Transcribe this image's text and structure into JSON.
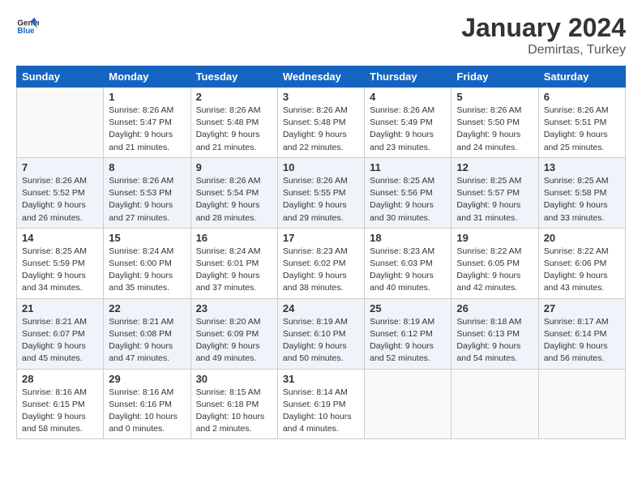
{
  "logo": {
    "text_general": "General",
    "text_blue": "Blue"
  },
  "title": {
    "month": "January 2024",
    "location": "Demirtas, Turkey"
  },
  "headers": [
    "Sunday",
    "Monday",
    "Tuesday",
    "Wednesday",
    "Thursday",
    "Friday",
    "Saturday"
  ],
  "weeks": [
    [
      {
        "day": "",
        "info": ""
      },
      {
        "day": "1",
        "info": "Sunrise: 8:26 AM\nSunset: 5:47 PM\nDaylight: 9 hours\nand 21 minutes."
      },
      {
        "day": "2",
        "info": "Sunrise: 8:26 AM\nSunset: 5:48 PM\nDaylight: 9 hours\nand 21 minutes."
      },
      {
        "day": "3",
        "info": "Sunrise: 8:26 AM\nSunset: 5:48 PM\nDaylight: 9 hours\nand 22 minutes."
      },
      {
        "day": "4",
        "info": "Sunrise: 8:26 AM\nSunset: 5:49 PM\nDaylight: 9 hours\nand 23 minutes."
      },
      {
        "day": "5",
        "info": "Sunrise: 8:26 AM\nSunset: 5:50 PM\nDaylight: 9 hours\nand 24 minutes."
      },
      {
        "day": "6",
        "info": "Sunrise: 8:26 AM\nSunset: 5:51 PM\nDaylight: 9 hours\nand 25 minutes."
      }
    ],
    [
      {
        "day": "7",
        "info": "Sunrise: 8:26 AM\nSunset: 5:52 PM\nDaylight: 9 hours\nand 26 minutes."
      },
      {
        "day": "8",
        "info": "Sunrise: 8:26 AM\nSunset: 5:53 PM\nDaylight: 9 hours\nand 27 minutes."
      },
      {
        "day": "9",
        "info": "Sunrise: 8:26 AM\nSunset: 5:54 PM\nDaylight: 9 hours\nand 28 minutes."
      },
      {
        "day": "10",
        "info": "Sunrise: 8:26 AM\nSunset: 5:55 PM\nDaylight: 9 hours\nand 29 minutes."
      },
      {
        "day": "11",
        "info": "Sunrise: 8:25 AM\nSunset: 5:56 PM\nDaylight: 9 hours\nand 30 minutes."
      },
      {
        "day": "12",
        "info": "Sunrise: 8:25 AM\nSunset: 5:57 PM\nDaylight: 9 hours\nand 31 minutes."
      },
      {
        "day": "13",
        "info": "Sunrise: 8:25 AM\nSunset: 5:58 PM\nDaylight: 9 hours\nand 33 minutes."
      }
    ],
    [
      {
        "day": "14",
        "info": "Sunrise: 8:25 AM\nSunset: 5:59 PM\nDaylight: 9 hours\nand 34 minutes."
      },
      {
        "day": "15",
        "info": "Sunrise: 8:24 AM\nSunset: 6:00 PM\nDaylight: 9 hours\nand 35 minutes."
      },
      {
        "day": "16",
        "info": "Sunrise: 8:24 AM\nSunset: 6:01 PM\nDaylight: 9 hours\nand 37 minutes."
      },
      {
        "day": "17",
        "info": "Sunrise: 8:23 AM\nSunset: 6:02 PM\nDaylight: 9 hours\nand 38 minutes."
      },
      {
        "day": "18",
        "info": "Sunrise: 8:23 AM\nSunset: 6:03 PM\nDaylight: 9 hours\nand 40 minutes."
      },
      {
        "day": "19",
        "info": "Sunrise: 8:22 AM\nSunset: 6:05 PM\nDaylight: 9 hours\nand 42 minutes."
      },
      {
        "day": "20",
        "info": "Sunrise: 8:22 AM\nSunset: 6:06 PM\nDaylight: 9 hours\nand 43 minutes."
      }
    ],
    [
      {
        "day": "21",
        "info": "Sunrise: 8:21 AM\nSunset: 6:07 PM\nDaylight: 9 hours\nand 45 minutes."
      },
      {
        "day": "22",
        "info": "Sunrise: 8:21 AM\nSunset: 6:08 PM\nDaylight: 9 hours\nand 47 minutes."
      },
      {
        "day": "23",
        "info": "Sunrise: 8:20 AM\nSunset: 6:09 PM\nDaylight: 9 hours\nand 49 minutes."
      },
      {
        "day": "24",
        "info": "Sunrise: 8:19 AM\nSunset: 6:10 PM\nDaylight: 9 hours\nand 50 minutes."
      },
      {
        "day": "25",
        "info": "Sunrise: 8:19 AM\nSunset: 6:12 PM\nDaylight: 9 hours\nand 52 minutes."
      },
      {
        "day": "26",
        "info": "Sunrise: 8:18 AM\nSunset: 6:13 PM\nDaylight: 9 hours\nand 54 minutes."
      },
      {
        "day": "27",
        "info": "Sunrise: 8:17 AM\nSunset: 6:14 PM\nDaylight: 9 hours\nand 56 minutes."
      }
    ],
    [
      {
        "day": "28",
        "info": "Sunrise: 8:16 AM\nSunset: 6:15 PM\nDaylight: 9 hours\nand 58 minutes."
      },
      {
        "day": "29",
        "info": "Sunrise: 8:16 AM\nSunset: 6:16 PM\nDaylight: 10 hours\nand 0 minutes."
      },
      {
        "day": "30",
        "info": "Sunrise: 8:15 AM\nSunset: 6:18 PM\nDaylight: 10 hours\nand 2 minutes."
      },
      {
        "day": "31",
        "info": "Sunrise: 8:14 AM\nSunset: 6:19 PM\nDaylight: 10 hours\nand 4 minutes."
      },
      {
        "day": "",
        "info": ""
      },
      {
        "day": "",
        "info": ""
      },
      {
        "day": "",
        "info": ""
      }
    ]
  ]
}
